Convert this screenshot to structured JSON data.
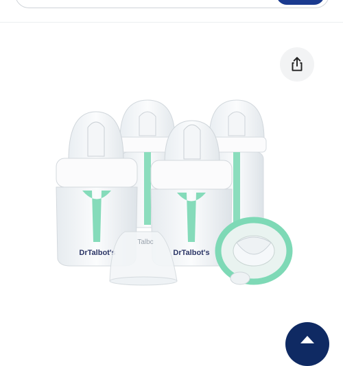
{
  "header": {
    "search_placeholder": ""
  },
  "product": {
    "image_alt": "Dr Talbot's bottle set with pacifier",
    "bottle_brand_text": "DrTalbot's",
    "nipple_cover_text": "Talbc"
  },
  "icons": {
    "share": "share-icon",
    "scroll_top": "chevron-up-icon"
  },
  "colors": {
    "accent_blue": "#1a3a8f",
    "mint": "#7ed9b6",
    "dark_navy": "#0f2a63",
    "brand_text": "#2b3566"
  }
}
